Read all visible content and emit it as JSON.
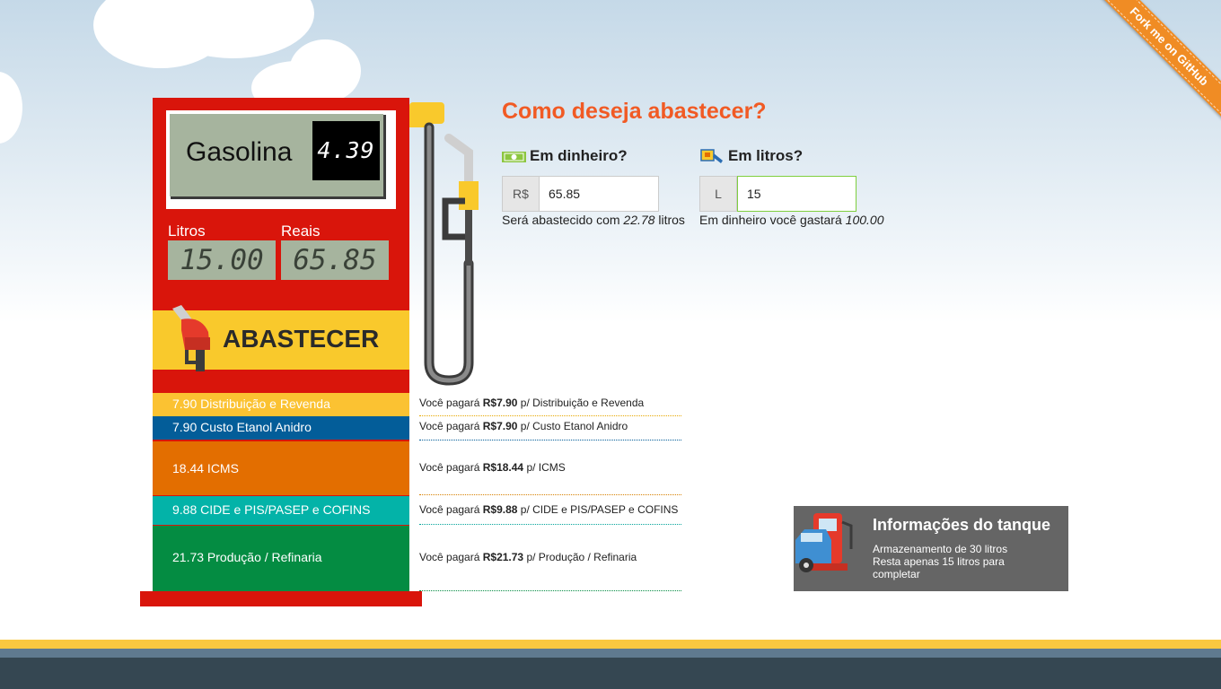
{
  "ribbon": {
    "label": "Fork me on GitHub"
  },
  "pump": {
    "fuel_name": "Gasolina",
    "price": "4.39",
    "litros_label": "Litros",
    "reais_label": "Reais",
    "litros_value": "15.00",
    "reais_value": "65.85",
    "button_label": "ABASTECER"
  },
  "taxes": [
    {
      "left": "7.90 Distribuição e Revenda",
      "prefix": "Você pagará",
      "amount": "R$7.90",
      "suffix": "p/ Distribuição e Revenda",
      "color": "#fbc232",
      "line": "#e7a800"
    },
    {
      "left": "7.90 Custo Etanol Anidro",
      "prefix": "Você pagará",
      "amount": "R$7.90",
      "suffix": "p/ Custo Etanol Anidro",
      "color": "#035d99",
      "line": "#035d99"
    },
    {
      "left": "18.44 ICMS",
      "prefix": "Você pagará",
      "amount": "R$18.44",
      "suffix": "p/ ICMS",
      "color": "#e36e00",
      "line": "#d68000"
    },
    {
      "left": "9.88 CIDE e PIS/PASEP e COFINS",
      "prefix": "Você pagará",
      "amount": "R$9.88",
      "suffix": "p/ CIDE e PIS/PASEP e COFINS",
      "color": "#03b3a8",
      "line": "#03a49a"
    },
    {
      "left": "21.73 Produção / Refinaria",
      "prefix": "Você pagará",
      "amount": "R$21.73",
      "suffix": "p/ Produção / Refinaria",
      "color": "#048c42",
      "line": "#048c42"
    }
  ],
  "form": {
    "question": "Como deseja abastecer?",
    "money": {
      "title": "Em dinheiro?",
      "addon": "R$",
      "value": "65.85",
      "helper_prefix": "Será abastecido com",
      "helper_value": "22.78",
      "helper_suffix": "litros"
    },
    "liters": {
      "title": "Em litros?",
      "addon": "L",
      "value": "15",
      "helper_prefix": "Em dinheiro você gastará",
      "helper_value": "100.00"
    }
  },
  "tank": {
    "title": "Informações do tanque",
    "line1": "Armazenamento de 30 litros",
    "line2": "Resta apenas 15 litros para completar"
  }
}
